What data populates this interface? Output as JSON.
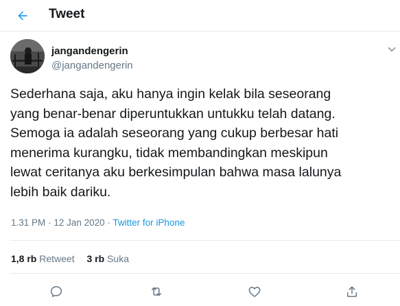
{
  "header": {
    "title": "Tweet"
  },
  "author": {
    "display_name": "jangandengerin",
    "username": "@jangandengerin"
  },
  "tweet": {
    "text": "Sederhana saja, aku hanya ingin kelak bila seseorang\nyang benar-benar diperuntukkan untukku telah datang.\nSemoga ia adalah seseorang yang cukup berbesar hati\nmenerima kurangku, tidak membandingkan meskipun\nlewat ceritanya aku berkesimpulan bahwa masa lalunya\nlebih baik dariku.",
    "time": "1.31 PM",
    "separator": "·",
    "date": "12 Jan 2020",
    "source": "Twitter for iPhone"
  },
  "stats": {
    "retweets_count": "1,8 rb",
    "retweets_label": "Retweet",
    "likes_count": "3 rb",
    "likes_label": "Suka"
  },
  "icons": {
    "back": "arrow-left-icon",
    "caret": "chevron-down-icon",
    "reply": "reply-icon",
    "retweet": "retweet-icon",
    "like": "heart-icon",
    "share": "share-icon"
  },
  "colors": {
    "accent": "#1da1f2",
    "link": "#1b95e0",
    "secondary_text": "#657786",
    "border": "#e6ecf0"
  }
}
